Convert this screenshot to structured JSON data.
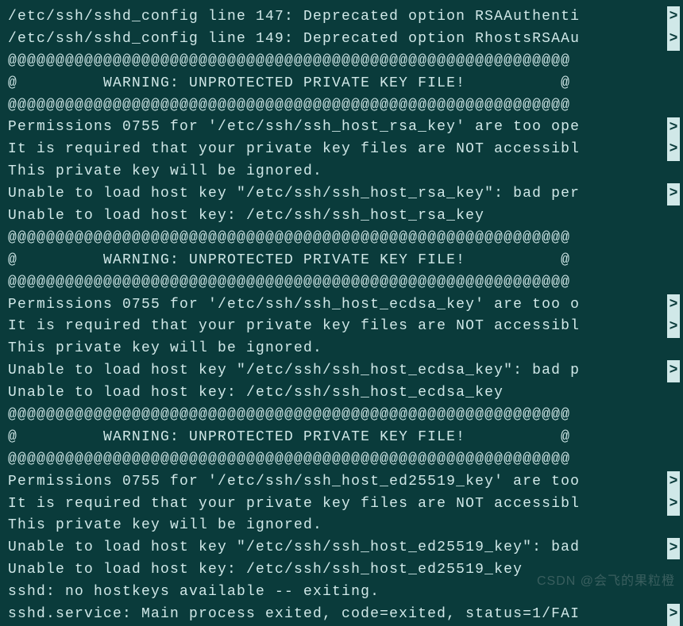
{
  "terminal": {
    "lines": [
      {
        "text": "/etc/ssh/sshd_config line 147: Deprecated option RSAAuthenti",
        "overflow": true
      },
      {
        "text": "/etc/ssh/sshd_config line 149: Deprecated option RhostsRSAAu",
        "overflow": true
      },
      {
        "text": "@@@@@@@@@@@@@@@@@@@@@@@@@@@@@@@@@@@@@@@@@@@@@@@@@@@@@@@@@@@",
        "overflow": false
      },
      {
        "text": "@         WARNING: UNPROTECTED PRIVATE KEY FILE!          @",
        "overflow": false
      },
      {
        "text": "@@@@@@@@@@@@@@@@@@@@@@@@@@@@@@@@@@@@@@@@@@@@@@@@@@@@@@@@@@@",
        "overflow": false
      },
      {
        "text": "Permissions 0755 for '/etc/ssh/ssh_host_rsa_key' are too ope",
        "overflow": true
      },
      {
        "text": "It is required that your private key files are NOT accessibl",
        "overflow": true
      },
      {
        "text": "This private key will be ignored.",
        "overflow": false
      },
      {
        "text": "Unable to load host key \"/etc/ssh/ssh_host_rsa_key\": bad per",
        "overflow": true
      },
      {
        "text": "Unable to load host key: /etc/ssh/ssh_host_rsa_key",
        "overflow": false
      },
      {
        "text": "@@@@@@@@@@@@@@@@@@@@@@@@@@@@@@@@@@@@@@@@@@@@@@@@@@@@@@@@@@@",
        "overflow": false
      },
      {
        "text": "@         WARNING: UNPROTECTED PRIVATE KEY FILE!          @",
        "overflow": false
      },
      {
        "text": "@@@@@@@@@@@@@@@@@@@@@@@@@@@@@@@@@@@@@@@@@@@@@@@@@@@@@@@@@@@",
        "overflow": false
      },
      {
        "text": "Permissions 0755 for '/etc/ssh/ssh_host_ecdsa_key' are too o",
        "overflow": true
      },
      {
        "text": "It is required that your private key files are NOT accessibl",
        "overflow": true
      },
      {
        "text": "This private key will be ignored.",
        "overflow": false
      },
      {
        "text": "Unable to load host key \"/etc/ssh/ssh_host_ecdsa_key\": bad p",
        "overflow": true
      },
      {
        "text": "Unable to load host key: /etc/ssh/ssh_host_ecdsa_key",
        "overflow": false
      },
      {
        "text": "@@@@@@@@@@@@@@@@@@@@@@@@@@@@@@@@@@@@@@@@@@@@@@@@@@@@@@@@@@@",
        "overflow": false
      },
      {
        "text": "@         WARNING: UNPROTECTED PRIVATE KEY FILE!          @",
        "overflow": false
      },
      {
        "text": "@@@@@@@@@@@@@@@@@@@@@@@@@@@@@@@@@@@@@@@@@@@@@@@@@@@@@@@@@@@",
        "overflow": false
      },
      {
        "text": "Permissions 0755 for '/etc/ssh/ssh_host_ed25519_key' are too",
        "overflow": true
      },
      {
        "text": "It is required that your private key files are NOT accessibl",
        "overflow": true
      },
      {
        "text": "This private key will be ignored.",
        "overflow": false
      },
      {
        "text": "Unable to load host key \"/etc/ssh/ssh_host_ed25519_key\": bad",
        "overflow": true
      },
      {
        "text": "Unable to load host key: /etc/ssh/ssh_host_ed25519_key",
        "overflow": false
      },
      {
        "text": "sshd: no hostkeys available -- exiting.",
        "overflow": false
      },
      {
        "text": "sshd.service: Main process exited, code=exited, status=1/FAI",
        "overflow": true
      }
    ],
    "overflow_char": ">"
  },
  "watermark": "CSDN @会飞的果粒橙"
}
